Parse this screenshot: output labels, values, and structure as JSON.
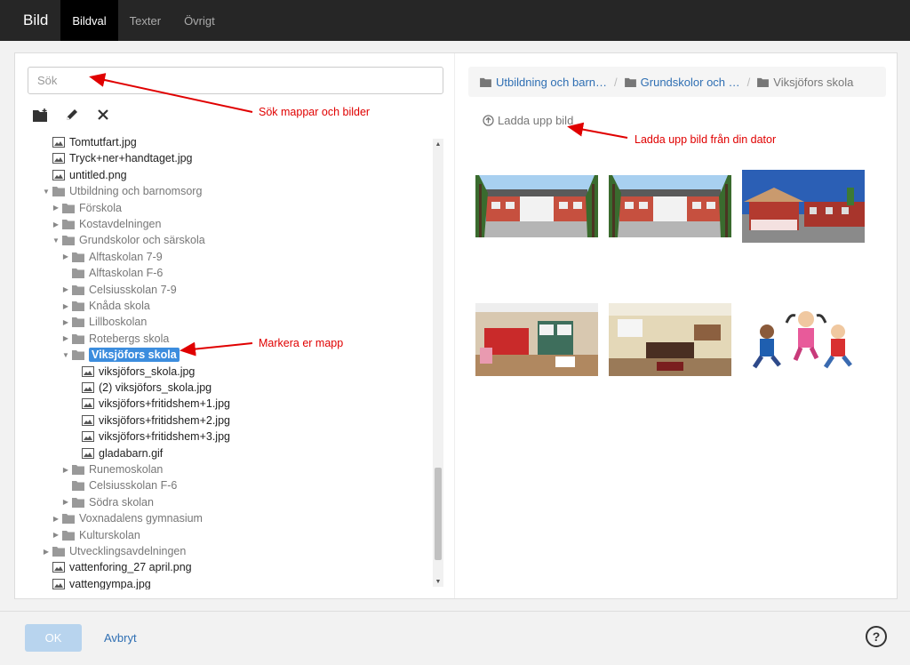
{
  "header": {
    "title": "Bild",
    "tabs": [
      {
        "label": "Bildval",
        "active": true
      },
      {
        "label": "Texter",
        "active": false
      },
      {
        "label": "Övrigt",
        "active": false
      }
    ]
  },
  "search": {
    "placeholder": "Sök"
  },
  "toolbar": {
    "icons": [
      "new-folder-icon",
      "pencil-icon",
      "close-icon"
    ]
  },
  "tree": [
    {
      "label": "Tomtutfart.jpg",
      "type": "file",
      "depth": 1
    },
    {
      "label": "Tryck+ner+handtaget.jpg",
      "type": "file",
      "depth": 1
    },
    {
      "label": "untitled.png",
      "type": "file",
      "depth": 1
    },
    {
      "label": "Utbildning och barnomsorg",
      "type": "folder",
      "depth": 1,
      "state": "open"
    },
    {
      "label": "Förskola",
      "type": "folder",
      "depth": 2,
      "state": "closed"
    },
    {
      "label": "Kostavdelningen",
      "type": "folder",
      "depth": 2,
      "state": "closed"
    },
    {
      "label": "Grundskolor och särskola",
      "type": "folder",
      "depth": 2,
      "state": "open"
    },
    {
      "label": "Alftaskolan 7-9",
      "type": "folder",
      "depth": 3,
      "state": "closed"
    },
    {
      "label": "Alftaskolan F-6",
      "type": "folder",
      "depth": 3,
      "state": "none"
    },
    {
      "label": "Celsiusskolan 7-9",
      "type": "folder",
      "depth": 3,
      "state": "closed"
    },
    {
      "label": "Knåda skola",
      "type": "folder",
      "depth": 3,
      "state": "closed"
    },
    {
      "label": "Lillboskolan",
      "type": "folder",
      "depth": 3,
      "state": "closed"
    },
    {
      "label": "Rotebergs skola",
      "type": "folder",
      "depth": 3,
      "state": "closed"
    },
    {
      "label": "Viksjöfors skola",
      "type": "folder",
      "depth": 3,
      "state": "open",
      "selected": true
    },
    {
      "label": "viksjöfors_skola.jpg",
      "type": "file",
      "depth": 4
    },
    {
      "label": "(2) viksjöfors_skola.jpg",
      "type": "file",
      "depth": 4
    },
    {
      "label": "viksjöfors+fritidshem+1.jpg",
      "type": "file",
      "depth": 4
    },
    {
      "label": "viksjöfors+fritidshem+2.jpg",
      "type": "file",
      "depth": 4
    },
    {
      "label": "viksjöfors+fritidshem+3.jpg",
      "type": "file",
      "depth": 4
    },
    {
      "label": "gladabarn.gif",
      "type": "file",
      "depth": 4
    },
    {
      "label": "Runemoskolan",
      "type": "folder",
      "depth": 3,
      "state": "closed"
    },
    {
      "label": "Celsiusskolan F-6",
      "type": "folder",
      "depth": 3,
      "state": "none"
    },
    {
      "label": "Södra skolan",
      "type": "folder",
      "depth": 3,
      "state": "closed"
    },
    {
      "label": "Voxnadalens gymnasium",
      "type": "folder",
      "depth": 2,
      "state": "closed"
    },
    {
      "label": "Kulturskolan",
      "type": "folder",
      "depth": 2,
      "state": "closed"
    },
    {
      "label": "Utvecklingsavdelningen",
      "type": "folder",
      "depth": 1,
      "state": "closed"
    },
    {
      "label": "vattenforing_27 april.png",
      "type": "file",
      "depth": 1
    },
    {
      "label": "vattengympa.jpg",
      "type": "file",
      "depth": 1
    }
  ],
  "breadcrumb": [
    {
      "label": "Utbildning och barn…"
    },
    {
      "label": "Grundskolor och …"
    },
    {
      "label": "Viksjöfors skola",
      "current": true
    }
  ],
  "upload": {
    "label": "Ladda upp bild"
  },
  "thumbnails": [
    {
      "kind": "school-building"
    },
    {
      "kind": "school-building"
    },
    {
      "kind": "red-building"
    },
    {
      "kind": "classroom-red"
    },
    {
      "kind": "classroom-lounge"
    },
    {
      "kind": "happy-children"
    }
  ],
  "annotations": {
    "search": "Sök mappar och bilder",
    "upload": "Ladda upp bild från din dator",
    "folder": "Markera er mapp"
  },
  "footer": {
    "ok": "OK",
    "cancel": "Avbryt",
    "help_icon": "question-circle-icon"
  },
  "colors": {
    "accent": "#3c8dde",
    "link": "#2f6fb3",
    "annotation": "#e00000",
    "header": "#262626"
  }
}
